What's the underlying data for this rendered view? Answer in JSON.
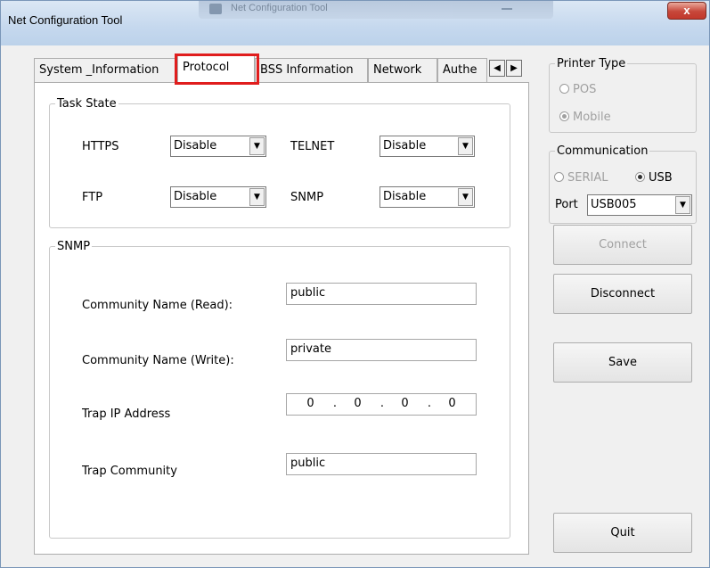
{
  "window": {
    "title": "Net Configuration Tool",
    "ghost_title": "Net Configuration Tool",
    "close_glyph": "x"
  },
  "tabs": [
    {
      "label": "System _Information",
      "active": false
    },
    {
      "label": "Protocol",
      "active": true
    },
    {
      "label": "BSS Information",
      "active": false
    },
    {
      "label": "Network",
      "active": false
    },
    {
      "label": "Authe",
      "active": false
    }
  ],
  "tab_scroll": {
    "left": "◀",
    "right": "▶"
  },
  "task_state": {
    "title": "Task State",
    "https": {
      "label": "HTTPS",
      "value": "Disable"
    },
    "telnet": {
      "label": "TELNET",
      "value": "Disable"
    },
    "ftp": {
      "label": "FTP",
      "value": "Disable"
    },
    "snmp": {
      "label": "SNMP",
      "value": "Disable"
    }
  },
  "snmp_group": {
    "title": "SNMP",
    "community_read": {
      "label": "Community Name (Read):",
      "value": "public"
    },
    "community_write": {
      "label": "Community Name (Write):",
      "value": "private"
    },
    "trap_ip": {
      "label": "Trap IP Address",
      "octets": [
        "0",
        "0",
        "0",
        "0"
      ]
    },
    "trap_community": {
      "label": "Trap Community",
      "value": "public"
    }
  },
  "printer_type": {
    "title": "Printer Type",
    "options": [
      {
        "label": "POS",
        "selected": false
      },
      {
        "label": "Mobile",
        "selected": true
      }
    ]
  },
  "communication": {
    "title": "Communication",
    "serial_label": "SERIAL",
    "usb_label": "USB",
    "selected": "USB",
    "port_label": "Port",
    "port_value": "USB005"
  },
  "buttons": {
    "connect": "Connect",
    "disconnect": "Disconnect",
    "save": "Save",
    "quit": "Quit"
  },
  "colors": {
    "highlight": "#e01d1d",
    "close_button": "#c7473a"
  },
  "icons": {
    "dropdown_arrow": "▼"
  }
}
